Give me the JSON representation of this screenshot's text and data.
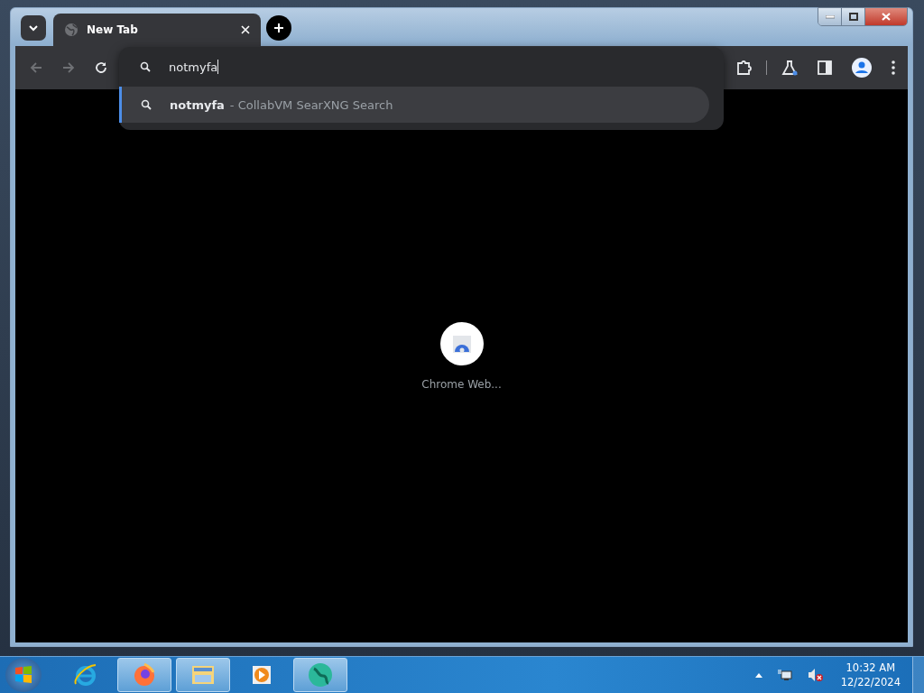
{
  "tabs": [
    {
      "title": "New Tab",
      "selected": true
    }
  ],
  "omnibox": {
    "value": "notmyfa",
    "suggestions": [
      {
        "query": "notmyfa",
        "source": "- CollabVM SearXNG Search",
        "selected": true
      }
    ]
  },
  "shortcuts": [
    {
      "label": "Chrome Web..."
    }
  ],
  "taskbar": {
    "items": [
      {
        "kind": "ie",
        "active": false
      },
      {
        "kind": "firefox",
        "active": true
      },
      {
        "kind": "explorer",
        "active": true
      },
      {
        "kind": "media",
        "active": false
      },
      {
        "kind": "globe",
        "active": true
      }
    ],
    "time": "10:32 AM",
    "date": "12/22/2024"
  }
}
